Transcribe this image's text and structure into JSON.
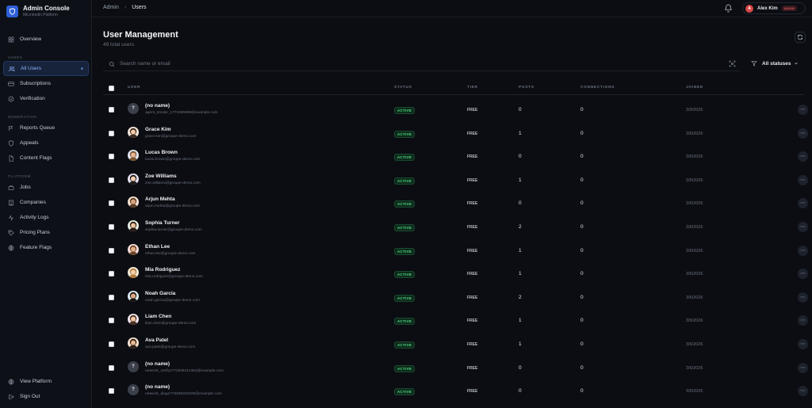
{
  "app": {
    "title": "Admin Console",
    "subtitle": "MiLinkedin Platform"
  },
  "sidebar": {
    "overview": "Overview",
    "sections": [
      {
        "label": "USERS",
        "items": [
          "All Users",
          "Subscriptions",
          "Verification"
        ]
      },
      {
        "label": "MODERATION",
        "items": [
          "Reports Queue",
          "Appeals",
          "Content Flags"
        ]
      },
      {
        "label": "PLATFORM",
        "items": [
          "Jobs",
          "Companies",
          "Activity Logs",
          "Pricing Plans",
          "Feature Flags"
        ]
      }
    ],
    "bottom": [
      "View Platform",
      "Sign Out"
    ]
  },
  "breadcrumb": {
    "root": "Admin",
    "current": "Users"
  },
  "user": {
    "initial": "A",
    "name": "Alex Kim",
    "role": "ADMIN"
  },
  "page": {
    "title": "User Management",
    "subtitle": "49 total users"
  },
  "search": {
    "placeholder": "Search name or email",
    "value": ""
  },
  "filter": {
    "label": "All statuses"
  },
  "table": {
    "headers": {
      "user": "USER",
      "status": "STATUS",
      "tier": "TIER",
      "posts": "POSTS",
      "connections": "CONNECTIONS",
      "joined": "JOINED"
    },
    "rows": [
      {
        "name": "(no name)",
        "email": "agent_smoke_1773485969@example.com",
        "status": "ACTIVE",
        "tier": "FREE",
        "posts": "0",
        "connections": "0",
        "joined": "3/9/2026",
        "avatar": "?"
      },
      {
        "name": "Grace Kim",
        "email": "grace.kim@groupe-demo.com",
        "status": "ACTIVE",
        "tier": "FREE",
        "posts": "1",
        "connections": "0",
        "joined": "3/6/2026",
        "avatar": "face-1"
      },
      {
        "name": "Lucas Brown",
        "email": "lucas.brown@groupe-demo.com",
        "status": "ACTIVE",
        "tier": "FREE",
        "posts": "0",
        "connections": "0",
        "joined": "3/6/2026",
        "avatar": "face-2"
      },
      {
        "name": "Zoe Williams",
        "email": "zoe.williams@groupe-demo.com",
        "status": "ACTIVE",
        "tier": "FREE",
        "posts": "1",
        "connections": "0",
        "joined": "3/5/2026",
        "avatar": "face-3"
      },
      {
        "name": "Arjun Mehta",
        "email": "arjun.mehta@groupe-demo.com",
        "status": "ACTIVE",
        "tier": "FREE",
        "posts": "0",
        "connections": "0",
        "joined": "3/6/2026",
        "avatar": "face-4"
      },
      {
        "name": "Sophia Turner",
        "email": "sophia.turner@groupe-demo.com",
        "status": "ACTIVE",
        "tier": "FREE",
        "posts": "2",
        "connections": "0",
        "joined": "3/6/2026",
        "avatar": "face-5"
      },
      {
        "name": "Ethan Lee",
        "email": "ethan.lee@groupe-demo.com",
        "status": "ACTIVE",
        "tier": "FREE",
        "posts": "1",
        "connections": "0",
        "joined": "3/6/2026",
        "avatar": "face-6"
      },
      {
        "name": "Mia Rodriguez",
        "email": "mia.rodriguez@groupe-demo.com",
        "status": "ACTIVE",
        "tier": "FREE",
        "posts": "1",
        "connections": "0",
        "joined": "3/6/2026",
        "avatar": "face-7"
      },
      {
        "name": "Noah Garcia",
        "email": "noah.garcia@groupe-demo.com",
        "status": "ACTIVE",
        "tier": "FREE",
        "posts": "2",
        "connections": "0",
        "joined": "3/6/2026",
        "avatar": "face-8"
      },
      {
        "name": "Liam Chen",
        "email": "liam.chen@groupe-demo.com",
        "status": "ACTIVE",
        "tier": "FREE",
        "posts": "1",
        "connections": "0",
        "joined": "3/6/2026",
        "avatar": "face-9"
      },
      {
        "name": "Ava Patel",
        "email": "ava.patel@groupe-demo.com",
        "status": "ACTIVE",
        "tier": "FREE",
        "posts": "1",
        "connections": "0",
        "joined": "3/6/2026",
        "avatar": "face-10"
      },
      {
        "name": "(no name)",
        "email": "network_verify1772938412363@example.com",
        "status": "ACTIVE",
        "tier": "FREE",
        "posts": "0",
        "connections": "0",
        "joined": "3/6/2026",
        "avatar": "?"
      },
      {
        "name": "(no name)",
        "email": "network_diag1772938310029@example.com",
        "status": "ACTIVE",
        "tier": "FREE",
        "posts": "0",
        "connections": "0",
        "joined": "3/6/2026",
        "avatar": "?"
      }
    ]
  },
  "colors": {
    "background": "#0b0d12",
    "accent": "#2f5fd6",
    "status_active": "#4ade80",
    "admin_badge": "#ff6b6b"
  },
  "icons": [
    "shield-icon",
    "grid-icon",
    "users-icon",
    "card-icon",
    "check-circle-icon",
    "flag-icon",
    "briefcase-icon",
    "building-icon",
    "activity-icon",
    "tag-icon",
    "globe-icon",
    "logout-icon",
    "bell-icon",
    "refresh-icon",
    "search-icon",
    "scan-icon",
    "filter-icon",
    "chevron-down-icon",
    "more-icon"
  ]
}
